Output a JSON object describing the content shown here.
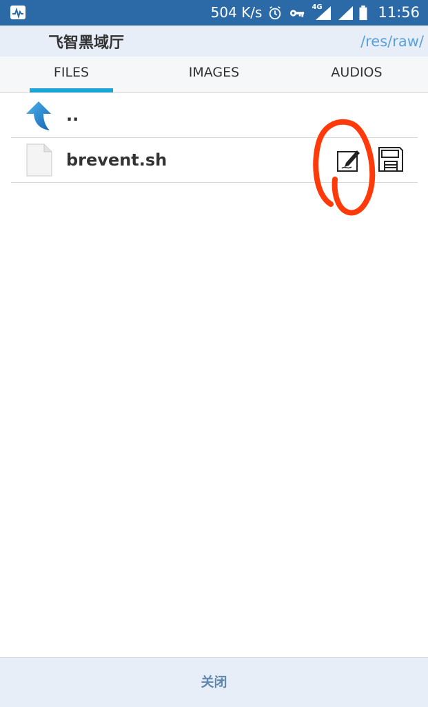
{
  "status_bar": {
    "net_speed": "504 K/s",
    "signal_label": "4G",
    "time": "11:56"
  },
  "header": {
    "title": "飞智黑域厅",
    "path": "/res/raw/"
  },
  "tabs": [
    {
      "label": "FILES",
      "selected": true
    },
    {
      "label": "IMAGES",
      "selected": false
    },
    {
      "label": "AUDIOS",
      "selected": false
    }
  ],
  "files": [
    {
      "name": "..",
      "icon": "up-arrow-icon"
    },
    {
      "name": "brevent.sh",
      "icon": "file-icon",
      "actions": [
        "edit-icon",
        "save-icon"
      ]
    }
  ],
  "bottom": {
    "close_label": "关闭"
  },
  "colors": {
    "status_bar": "#2b6aa7",
    "accent": "#1aa4d8",
    "annotation": "#ff3a0a"
  }
}
